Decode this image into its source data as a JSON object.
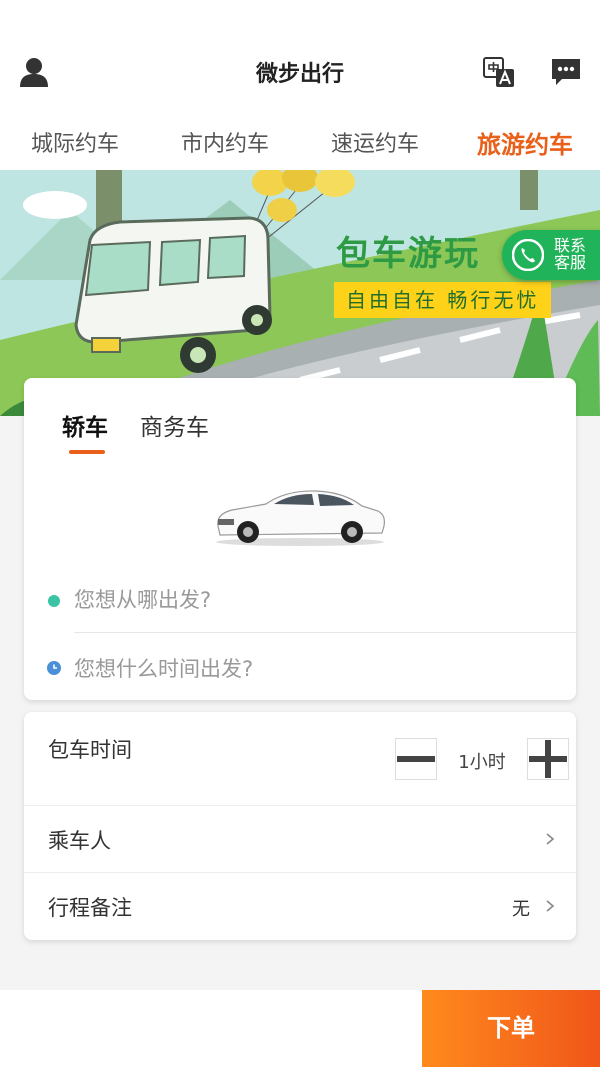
{
  "header": {
    "title": "微步出行",
    "icons": {
      "left": "user-icon",
      "right": [
        "translate-icon",
        "message-icon"
      ]
    }
  },
  "tabs": [
    {
      "label": "城际约车",
      "active": false
    },
    {
      "label": "市内约车",
      "active": false
    },
    {
      "label": "速运约车",
      "active": false
    },
    {
      "label": "旅游约车",
      "active": true
    }
  ],
  "banner": {
    "headline": "包车游玩",
    "slogan": "自由自在 畅行无忧"
  },
  "customer_service": {
    "label_line1": "联系",
    "label_line2": "客服",
    "icon": "phone-icon"
  },
  "booking": {
    "vehicle_tabs": [
      {
        "label": "轿车",
        "active": true
      },
      {
        "label": "商务车",
        "active": false
      }
    ],
    "from_placeholder": "您想从哪出发?",
    "time_placeholder": "您想什么时间出发?"
  },
  "options": {
    "duration_label": "包车时间",
    "duration_value": "1小时",
    "passenger_label": "乘车人",
    "notes_label": "行程备注",
    "notes_value": "无"
  },
  "footer": {
    "order_label": "下单"
  },
  "colors": {
    "accent": "#e8601a",
    "order_start": "#ff8a1c",
    "order_end": "#f0561a",
    "service_green": "#21b35a",
    "from_dot": "#3ac4a4",
    "time_dot": "#4a90d9",
    "banner_headline": "#2e9a44",
    "banner_slogan_bg": "#ffd21a"
  }
}
